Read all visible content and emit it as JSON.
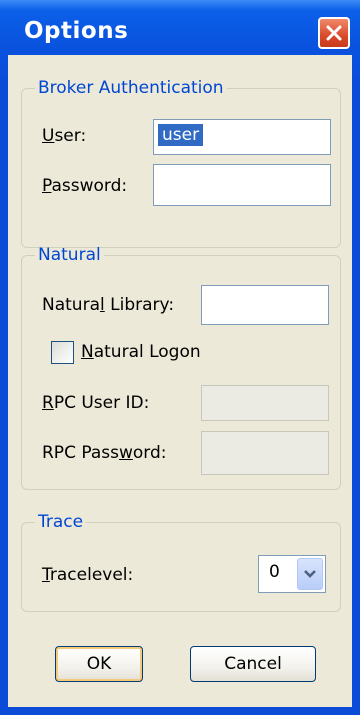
{
  "window": {
    "title": "Options"
  },
  "broker": {
    "legend": "Broker Authentication",
    "user_label_mn": "U",
    "user_label_rest": "ser:",
    "user_value": "user",
    "password_label_mn": "P",
    "password_label_rest": "assword:",
    "password_value": ""
  },
  "natural": {
    "legend": "Natural",
    "library_label_pre": "Natura",
    "library_label_mn": "l",
    "library_label_post": " Library:",
    "library_value": "",
    "logon_label_mn": "N",
    "logon_label_rest": "atural Logon",
    "logon_checked": false,
    "rpc_user_label_mn": "R",
    "rpc_user_label_rest": "PC User ID:",
    "rpc_password_label_pre": "RPC Pass",
    "rpc_password_label_mn": "w",
    "rpc_password_label_post": "ord:"
  },
  "trace": {
    "legend": "Trace",
    "level_label_mn": "T",
    "level_label_rest": "racelevel:",
    "level_value": "0"
  },
  "buttons": {
    "ok": "OK",
    "cancel": "Cancel"
  },
  "colors": {
    "title_bar": "#0a4bd8",
    "close": "#d84a2a",
    "legend": "#0046d5",
    "face": "#ece9d8"
  }
}
